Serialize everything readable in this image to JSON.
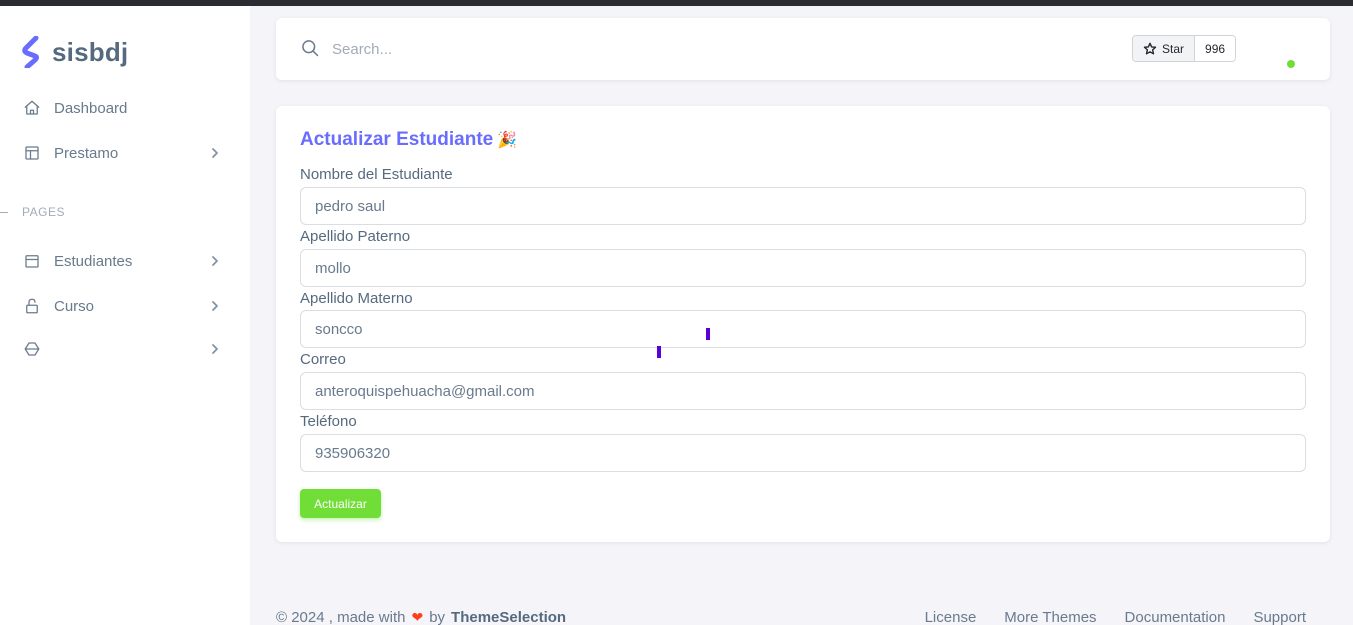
{
  "brand": {
    "name": "sisbdj"
  },
  "sidebar": {
    "items": [
      {
        "label": "Dashboard"
      },
      {
        "label": "Prestamo"
      },
      {
        "label": "Estudiantes"
      },
      {
        "label": "Curso"
      },
      {
        "label": ""
      }
    ],
    "section_header": "PAGES"
  },
  "navbar": {
    "search_placeholder": "Search...",
    "star_label": "Star",
    "star_count": "996",
    "status_color": "#71dd37"
  },
  "form": {
    "title": "Actualizar Estudiante",
    "title_emoji": "🎉",
    "fields": [
      {
        "label": "Nombre del Estudiante",
        "value": "pedro saul"
      },
      {
        "label": "Apellido Paterno",
        "value": "mollo"
      },
      {
        "label": "Apellido Materno",
        "value": "soncco"
      },
      {
        "label": "Correo",
        "value": "anteroquispehuacha@gmail.com"
      },
      {
        "label": "Teléfono",
        "value": "935906320"
      }
    ],
    "submit_label": "Actualizar"
  },
  "footer": {
    "copyright_prefix": "© 2024 , made with",
    "by": "by",
    "brand": "ThemeSelection",
    "links": [
      "License",
      "More Themes",
      "Documentation",
      "Support"
    ]
  },
  "colors": {
    "primary": "#696cff",
    "success": "#71dd37",
    "heart": "#ff3e1d"
  }
}
